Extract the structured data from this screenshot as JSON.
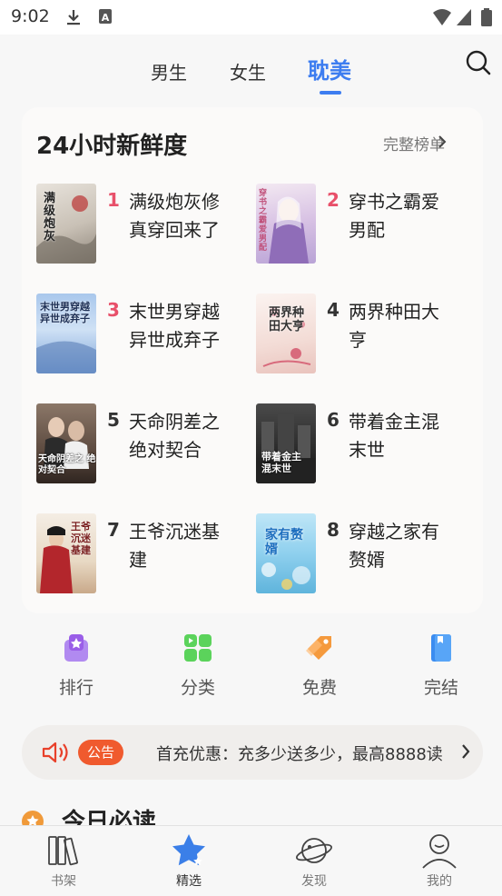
{
  "status_bar": {
    "time": "9:02",
    "icons": [
      "download-icon",
      "a-badge-icon",
      "wifi-icon",
      "cell-signal-icon",
      "battery-icon"
    ]
  },
  "top_nav": {
    "tabs": [
      {
        "label": "男生",
        "active": false
      },
      {
        "label": "女生",
        "active": false
      },
      {
        "label": "耽美",
        "active": true
      }
    ],
    "search_icon": "search-icon",
    "accent_color": "#3d7df0"
  },
  "ranking": {
    "title": "24小时新鲜度",
    "more_label": "完整榜单",
    "books": [
      {
        "rank": "1",
        "title": "满级炮灰修真穿回来了",
        "cover_text": "满级炮灰"
      },
      {
        "rank": "2",
        "title": "穿书之霸爱男配",
        "cover_text": "穿书之霸爱男配"
      },
      {
        "rank": "3",
        "title": "末世男穿越异世成弃子",
        "cover_text": "末世男穿越 异世成弃子"
      },
      {
        "rank": "4",
        "title": "两界种田大亨",
        "cover_text": "两界种田大亨"
      },
      {
        "rank": "5",
        "title": "天命阴差之绝对契合",
        "cover_text": "天命阴差之 绝对契合"
      },
      {
        "rank": "6",
        "title": "带着金主混末世",
        "cover_text": "带着金主 混末世"
      },
      {
        "rank": "7",
        "title": "王爷沉迷基建",
        "cover_text": "王爷沉迷基建"
      },
      {
        "rank": "8",
        "title": "穿越之家有赘婿",
        "cover_text": "家有赘婿"
      }
    ],
    "hot_rank_color": "#e8506a"
  },
  "quick_links": [
    {
      "label": "排行",
      "icon": "ranking-icon"
    },
    {
      "label": "分类",
      "icon": "category-icon"
    },
    {
      "label": "免费",
      "icon": "free-tag-icon"
    },
    {
      "label": "完结",
      "icon": "finished-book-icon"
    }
  ],
  "notice": {
    "badge": "公告",
    "text": "首充优惠：充多少送多少，最高8888读",
    "icon": "speaker-icon"
  },
  "today": {
    "title": "今日必读"
  },
  "bottom_nav": {
    "items": [
      {
        "label": "书架",
        "icon": "bookshelf-icon",
        "active": false
      },
      {
        "label": "精选",
        "icon": "star-icon",
        "active": true
      },
      {
        "label": "发现",
        "icon": "planet-icon",
        "active": false
      },
      {
        "label": "我的",
        "icon": "profile-icon",
        "active": false
      }
    ]
  }
}
